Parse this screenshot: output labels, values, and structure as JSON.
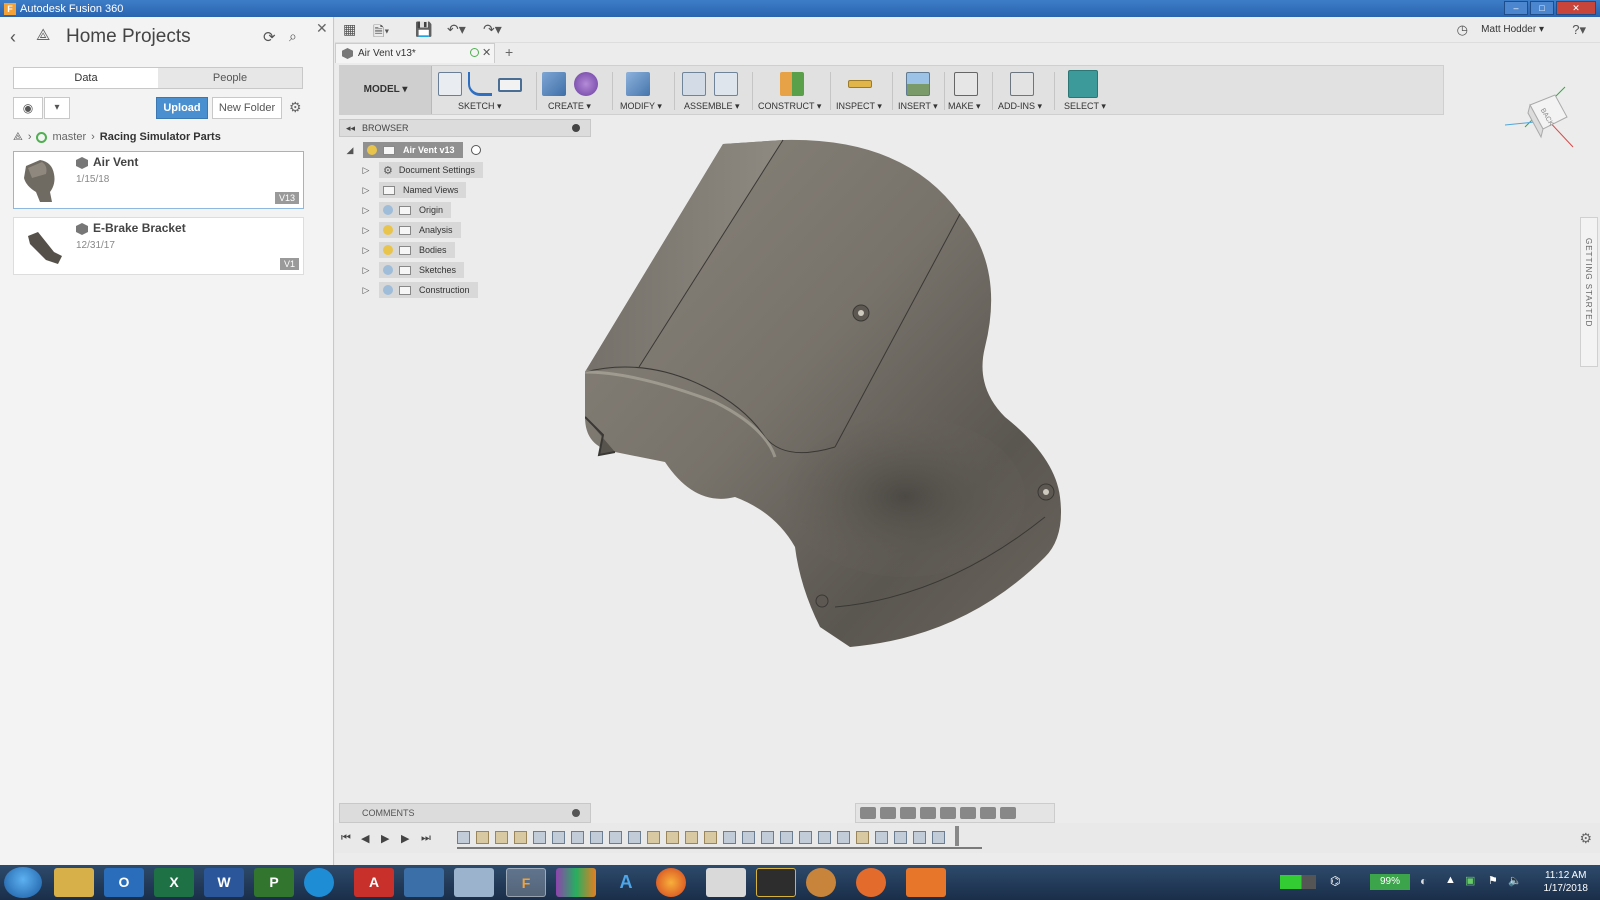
{
  "window": {
    "title": "Autodesk Fusion 360"
  },
  "left_panel": {
    "title": "Home Projects",
    "tabs": [
      {
        "label": "Data"
      },
      {
        "label": "People"
      }
    ],
    "upload_label": "Upload",
    "new_folder_label": "New Folder",
    "breadcrumb": [
      {
        "label": "master"
      },
      {
        "label": "Racing Simulator Parts"
      }
    ],
    "files": [
      {
        "name": "Air Vent",
        "date": "1/15/18",
        "version": "V13"
      },
      {
        "name": "E-Brake Bracket",
        "date": "12/31/17",
        "version": "V1"
      }
    ]
  },
  "qat": {
    "user": "Matt Hodder ▾"
  },
  "doc_tab": {
    "label": "Air Vent v13*"
  },
  "ribbon": {
    "workspace": "MODEL ▾",
    "groups": [
      {
        "label": "SKETCH ▾"
      },
      {
        "label": "CREATE ▾"
      },
      {
        "label": "MODIFY ▾"
      },
      {
        "label": "ASSEMBLE ▾"
      },
      {
        "label": "CONSTRUCT ▾"
      },
      {
        "label": "INSPECT ▾"
      },
      {
        "label": "INSERT ▾"
      },
      {
        "label": "MAKE ▾"
      },
      {
        "label": "ADD-INS ▾"
      },
      {
        "label": "SELECT ▾"
      }
    ]
  },
  "browser": {
    "title": "BROWSER",
    "root": "Air Vent v13",
    "items": [
      {
        "label": "Document Settings"
      },
      {
        "label": "Named Views"
      },
      {
        "label": "Origin"
      },
      {
        "label": "Analysis"
      },
      {
        "label": "Bodies"
      },
      {
        "label": "Sketches"
      },
      {
        "label": "Construction"
      }
    ]
  },
  "viewcube": {
    "face": "BACK"
  },
  "getting_started": {
    "label": "GETTING STARTED"
  },
  "comments": {
    "title": "COMMENTS"
  },
  "taskbar": {
    "apps": [
      "O",
      "X",
      "W",
      "P",
      "A",
      "F",
      "A"
    ],
    "battery": "99%",
    "time": "11:12 AM",
    "date": "1/17/2018"
  }
}
